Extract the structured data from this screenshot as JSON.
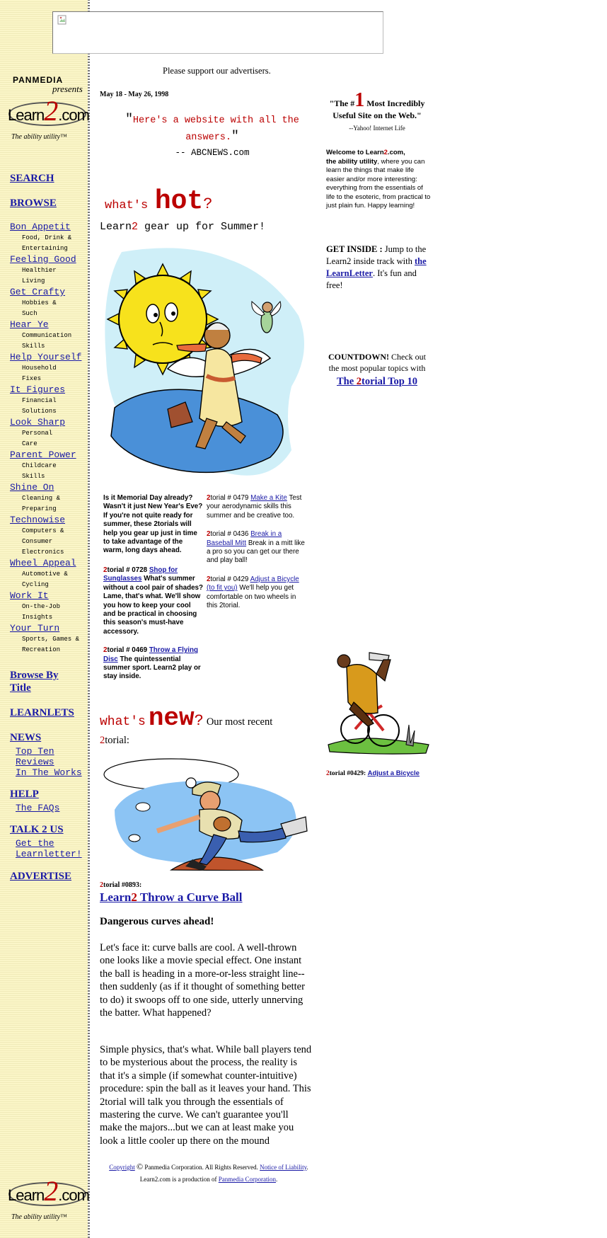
{
  "ad": {
    "support_text": "Please support our advertisers."
  },
  "brand": {
    "panmedia": "PANMEDIA",
    "presents": "presents",
    "learn": "Learn",
    "two": "2",
    "dotcom": ".com",
    "tagline": "The ability utility",
    "tm": "™"
  },
  "sidebar": {
    "search": "SEARCH",
    "browse": "BROWSE",
    "categories": [
      {
        "label": "Bon Appetit",
        "sub": [
          "Food, Drink &",
          "Entertaining"
        ]
      },
      {
        "label": "Feeling Good",
        "sub": [
          "Healthier",
          "Living"
        ]
      },
      {
        "label": "Get Crafty",
        "sub": [
          "Hobbies &",
          "Such"
        ]
      },
      {
        "label": "Hear Ye",
        "sub": [
          "Communication",
          "Skills"
        ]
      },
      {
        "label": "Help Yourself",
        "sub": [
          "Household",
          "Fixes"
        ]
      },
      {
        "label": "It Figures",
        "sub": [
          "Financial",
          "Solutions"
        ]
      },
      {
        "label": "Look Sharp",
        "sub": [
          "Personal",
          "Care"
        ]
      },
      {
        "label": "Parent Power",
        "sub": [
          "Childcare",
          "Skills"
        ]
      },
      {
        "label": "Shine On",
        "sub": [
          "Cleaning &",
          "Preparing"
        ]
      },
      {
        "label": "Technowise",
        "sub": [
          "Computers &",
          "Consumer",
          "Electronics"
        ]
      },
      {
        "label": "Wheel Appeal",
        "sub": [
          "Automotive &",
          "Cycling"
        ]
      },
      {
        "label": "Work It",
        "sub": [
          "On-the-Job",
          "Insights"
        ]
      },
      {
        "label": "Your Turn",
        "sub": [
          "Sports, Games &",
          "Recreation"
        ]
      }
    ],
    "browse_by_title_1": "Browse By",
    "browse_by_title_2": "Title",
    "learnlets": "LEARNLETS",
    "news": "NEWS",
    "news_items": [
      "Top Ten",
      "Reviews",
      "In The Works"
    ],
    "help": "HELP",
    "help_items": [
      "The FAQs"
    ],
    "talk": "TALK 2 US",
    "talk_items": [
      "Get the",
      "Learnletter!"
    ],
    "advertise": "ADVERTISE"
  },
  "main": {
    "date": "May 18 - May 26, 1998",
    "quote_line1": "Here's a website with all the",
    "quote_line2": "answers.",
    "quote_source": "-- ABCNEWS.com",
    "hot_prefix": "what's",
    "hot_big": "hot",
    "hot_q": "?",
    "hot_title_a": "Learn",
    "hot_title_two": "2",
    "hot_title_b": " gear up for Summer!",
    "intro_text": "Is it Memorial Day already? Wasn't it just New Year's Eve? If you're not quite ready for summer, these 2torials will help you gear up just in time to take advantage of the warm, long days ahead.",
    "tut_left": [
      {
        "num": "torial # 0728",
        "link": "Shop for Sunglasses",
        "desc": "What's summer without a cool pair of shades? Lame, that's what. We'll show you how to keep your cool and be practical in choosing this season's must-have accessory."
      },
      {
        "num": "torial # 0469",
        "link": "Throw a Flying Disc",
        "desc": "The quintessential summer sport. Learn2 play or stay inside."
      }
    ],
    "tut_right": [
      {
        "num": "torial # 0479",
        "link": "Make a Kite",
        "desc": "Test your aerodynamic skills this summer and be creative too."
      },
      {
        "num": "torial # 0436",
        "link": "Break in a Baseball Mitt",
        "desc": "Break in a mitt like a pro so you can get our there and play ball!"
      },
      {
        "num": "torial # 0429",
        "link": "Adjust a Bicycle (to fit you)",
        "desc": "We'll help you get comfortable on two wheels in this 2torial."
      }
    ],
    "new_prefix": "what's",
    "new_big": "new",
    "new_q": "?",
    "new_tail": "Our most recent",
    "new_tail2": "torial:",
    "feat_num": "torial #0893:",
    "feat_title_a": "Learn",
    "feat_title_two": "2",
    "feat_title_b": " Throw a Curve Ball",
    "feat_sub": "Dangerous curves ahead!",
    "feat_p1": "Let's face it: curve balls are cool. A well-thrown one looks like a movie special effect. One instant the ball is heading in a more-or-less straight line--then suddenly (as if it thought of something better to do) it swoops off to one side, utterly unnerving the batter. What happened?",
    "feat_p2": "Simple physics, that's what. While ball players tend to be mysterious about the process, the reality is that it's a simple (if somewhat counter-intuitive) procedure: spin the ball as it leaves your hand. This 2torial will talk you through the essentials of mastering the curve. We can't guarantee you'll make the majors...but we can at least make you look a little cooler up there on the mound"
  },
  "right": {
    "praise_a": "\"The #",
    "praise_num": "1",
    "praise_b": " Most Incredibly Useful Site on the Web.\"",
    "praise_src": "--Yahoo! Internet Life",
    "welcome_a": "Welcome to Learn",
    "welcome_two": "2",
    "welcome_b": ".com,",
    "welcome_c": "the ability utility",
    "welcome_d": ", where you can learn the things that make life easier and/or more interesting: everything from the essentials of life to the esoteric, from practical to just plain fun. Happy learning!",
    "inside_head": "GET INSIDE :",
    "inside_a": " Jump to the Learn2 inside track with ",
    "inside_link": "the LearnLetter",
    "inside_b": ". It's fun and free!",
    "count_head": "COUNTDOWN!",
    "count_a": " Check out",
    "count_b": "the most popular topics with",
    "count_link_a": "The ",
    "count_link_two": "2",
    "count_link_b": "torial Top 10",
    "bike_num": "torial #0429:",
    "bike_link": "Adjust a Bicycle"
  },
  "footer": {
    "copyright": "Copyright",
    "corp": " Panmedia Corporation. All Rights Reserved. ",
    "notice": "Notice of Liability",
    "production": "Learn2.com is a production of ",
    "production_link": "Panmedia Corporation",
    "period": "."
  },
  "colors": {
    "sidebar_bg": "#fbf6c8",
    "link": "#1a1aa6",
    "accent_red": "#bb0000"
  }
}
